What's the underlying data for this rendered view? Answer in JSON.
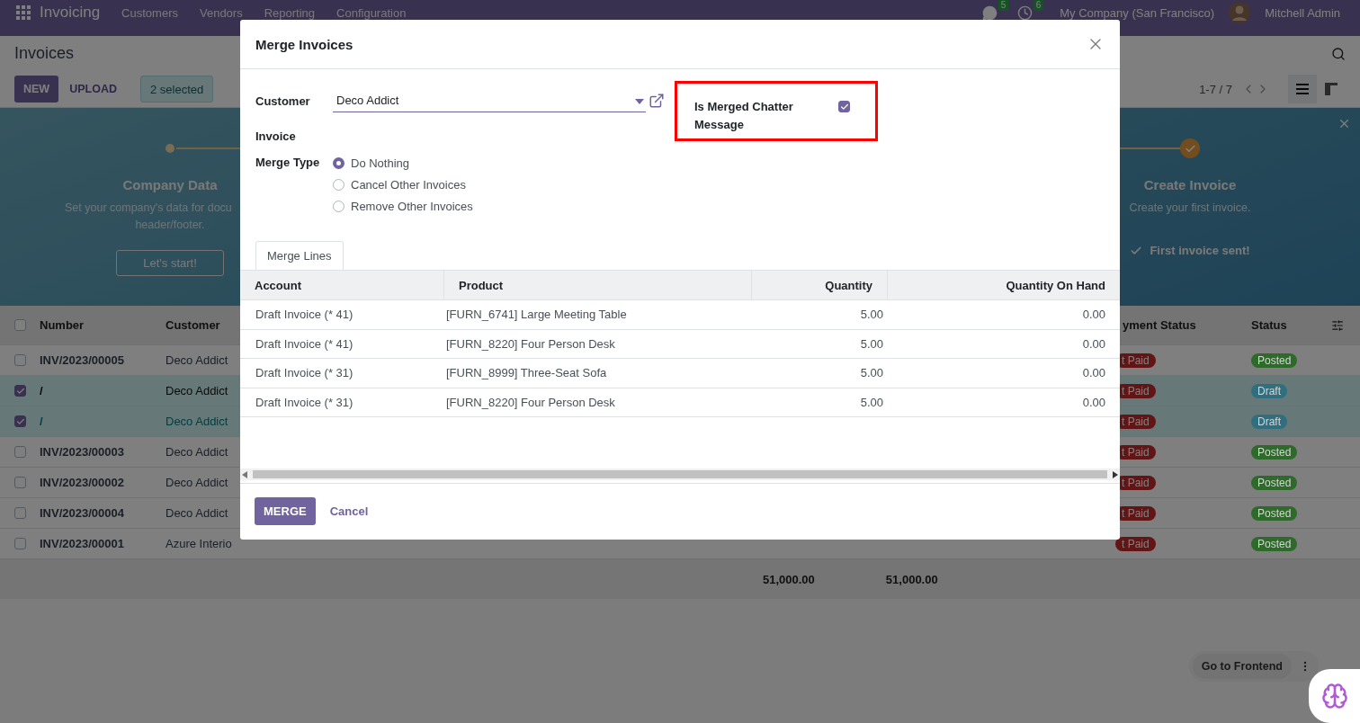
{
  "navbar": {
    "app_name": "Invoicing",
    "menus": [
      "Customers",
      "Vendors",
      "Reporting",
      "Configuration"
    ],
    "messages_badge": "5",
    "activities_badge": "6",
    "company": "My Company (San Francisco)",
    "user": "Mitchell Admin"
  },
  "control_panel": {
    "title": "Invoices",
    "buttons": [
      {
        "label": "NEW",
        "kind": "primary"
      },
      {
        "label": "UPLOAD",
        "kind": "secondary"
      }
    ],
    "selection": "2 selected",
    "pager": "1-7 / 7",
    "views": [
      {
        "kind": "list",
        "selected": true
      },
      {
        "kind": "kanban",
        "selected": false
      }
    ]
  },
  "onboarding": {
    "steps": [
      {
        "title": "Company Data",
        "description": [
          "Set your company's data for docu",
          "header/footer."
        ],
        "button": "Let's start!",
        "done": false
      },
      {
        "title": "Create Invoice",
        "description": [
          "Create your first invoice."
        ],
        "done_text": "First invoice sent!",
        "done": true
      }
    ]
  },
  "list": {
    "select_all_checked": false,
    "columns": [
      "Number",
      "Customer",
      "yment Status",
      "Status"
    ],
    "rows": [
      {
        "number": "INV/2023/00005",
        "customer": "Deco Addict",
        "payment": "t Paid",
        "status": {
          "label": "Posted",
          "color": "#2e6a2a"
        },
        "checked": false,
        "focused": false
      },
      {
        "number": "/",
        "customer": "Deco Addict",
        "payment": "t Paid",
        "status": {
          "label": "Draft",
          "color": "#2f6f80"
        },
        "checked": true,
        "focused": false
      },
      {
        "number": "/",
        "customer": "Deco Addict",
        "payment": "t Paid",
        "status": {
          "label": "Draft",
          "color": "#2f6f80"
        },
        "checked": true,
        "focused": true
      },
      {
        "number": "INV/2023/00003",
        "customer": "Deco Addict",
        "payment": "t Paid",
        "status": {
          "label": "Posted",
          "color": "#2e6a2a"
        },
        "checked": false,
        "focused": false
      },
      {
        "number": "INV/2023/00002",
        "customer": "Deco Addict",
        "payment": "t Paid",
        "status": {
          "label": "Posted",
          "color": "#2e6a2a"
        },
        "checked": false,
        "focused": false
      },
      {
        "number": "INV/2023/00004",
        "customer": "Deco Addict",
        "payment": "t Paid",
        "status": {
          "label": "Posted",
          "color": "#2e6a2a"
        },
        "checked": false,
        "focused": false
      },
      {
        "number": "INV/2023/00001",
        "customer": "Azure Interio",
        "payment": "t Paid",
        "status": {
          "label": "Posted",
          "color": "#2e6a2a"
        },
        "checked": false,
        "focused": false
      }
    ],
    "totals": [
      "51,000.00",
      "51,000.00"
    ]
  },
  "dialog": {
    "title": "Merge Invoices",
    "customer_label": "Customer",
    "customer_value": "Deco Addict",
    "chatter": {
      "label": "Is Merged Chatter Message",
      "checked": true,
      "highlighted": true
    },
    "invoice_label": "Invoice",
    "merge_type_label": "Merge Type",
    "merge_options": [
      {
        "label": "Do Nothing",
        "selected": true
      },
      {
        "label": "Cancel Other Invoices",
        "selected": false
      },
      {
        "label": "Remove Other Invoices",
        "selected": false
      }
    ],
    "tabs": [
      {
        "label": "Merge Lines",
        "selected": true
      }
    ],
    "lines": {
      "columns": [
        "Account",
        "Product",
        "Quantity",
        "Quantity On Hand"
      ],
      "rows": [
        {
          "account": "Draft Invoice (* 41)",
          "product": "[FURN_6741] Large Meeting Table",
          "quantity": "5.00",
          "on_hand": "0.00"
        },
        {
          "account": "Draft Invoice (* 41)",
          "product": "[FURN_8220] Four Person Desk",
          "quantity": "5.00",
          "on_hand": "0.00"
        },
        {
          "account": "Draft Invoice (* 31)",
          "product": "[FURN_8999] Three-Seat Sofa",
          "quantity": "5.00",
          "on_hand": "0.00"
        },
        {
          "account": "Draft Invoice (* 31)",
          "product": "[FURN_8220] Four Person Desk",
          "quantity": "5.00",
          "on_hand": "0.00"
        }
      ]
    },
    "buttons": [
      {
        "label": "MERGE",
        "kind": "primary"
      },
      {
        "label": "Cancel",
        "kind": "link"
      }
    ]
  },
  "floating": {
    "frontend_button": "Go to Frontend"
  }
}
